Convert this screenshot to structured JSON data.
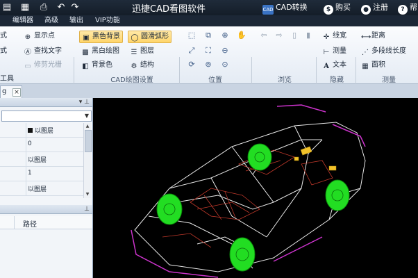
{
  "titlebar": {
    "app_title": "迅捷CAD看图软件",
    "cad_convert": "CAD转换",
    "buy": "购买",
    "register": "注册",
    "help": "帮",
    "cad_badge": "CAD"
  },
  "menu": [
    "编辑器",
    "高级",
    "输出",
    "VIP功能"
  ],
  "ribbon": {
    "left_col": [
      "显示点",
      "查找文字",
      "修剪光栅"
    ],
    "left_edge": [
      "式",
      "式",
      "工具"
    ],
    "cad_settings": [
      "黑色背景",
      "圆滑弧形",
      "黑白绘图",
      "图层",
      "背景色",
      "结构"
    ],
    "measure": [
      "距离",
      "多段线长度",
      "面积"
    ],
    "hide": [
      "线宽",
      "测量",
      "文本"
    ],
    "groups": {
      "cad_settings": "CAD绘图设置",
      "position": "位置",
      "browse": "浏览",
      "hide": "隐藏",
      "measure": "测量"
    }
  },
  "doctab": {
    "label": "g",
    "close": "×"
  },
  "properties": {
    "rows": [
      {
        "value": "以图层",
        "swatch": true
      },
      {
        "value": "0",
        "swatch": false
      },
      {
        "value": "以图层",
        "swatch": false
      },
      {
        "value": "1",
        "swatch": false
      },
      {
        "value": "以图层",
        "swatch": false
      }
    ]
  },
  "list": {
    "path_header": "路径"
  },
  "colors": {
    "titlebar": "#1a2533",
    "canvas": "#000000",
    "wire_white": "#e8e8e8",
    "wire_red": "#c0392b",
    "wire_magenta": "#cc33cc",
    "wheel_green": "#22dd22",
    "accent_yellow": "#f2c22a"
  }
}
